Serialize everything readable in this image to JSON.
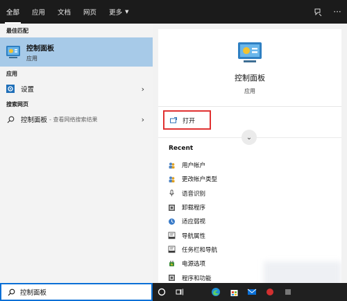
{
  "tabs": [
    {
      "label": "全部"
    },
    {
      "label": "应用"
    },
    {
      "label": "文档"
    },
    {
      "label": "网页"
    },
    {
      "label": "更多"
    }
  ],
  "left": {
    "best_match_title": "最佳匹配",
    "best_match": {
      "name": "控制面板",
      "kind": "应用"
    },
    "apps_title": "应用",
    "apps": [
      {
        "label": "设置",
        "icon": "gear-icon"
      }
    ],
    "web_title": "搜索网页",
    "web": [
      {
        "label": "控制面板",
        "sub": "- 查看网络搜索结果",
        "icon": "search-icon"
      }
    ]
  },
  "right": {
    "name": "控制面板",
    "kind": "应用",
    "open_label": "打开",
    "recent_title": "Recent",
    "recent": [
      {
        "label": "用户帐户",
        "icon": "users-icon"
      },
      {
        "label": "更改帐户类型",
        "icon": "users-icon"
      },
      {
        "label": "语音识别",
        "icon": "microphone-icon"
      },
      {
        "label": "卸载程序",
        "icon": "programs-icon"
      },
      {
        "label": "适应弱视",
        "icon": "ease-of-access-icon"
      },
      {
        "label": "导航属性",
        "icon": "taskbar-icon"
      },
      {
        "label": "任务栏和导航",
        "icon": "taskbar-icon"
      },
      {
        "label": "电源选项",
        "icon": "power-icon"
      },
      {
        "label": "程序和功能",
        "icon": "programs-icon"
      }
    ]
  },
  "taskbar": {
    "search_value": "控制面板"
  },
  "colors": {
    "accent": "#0a6fd6",
    "highlight": "#a7cae8",
    "open_box": "#e03030"
  }
}
